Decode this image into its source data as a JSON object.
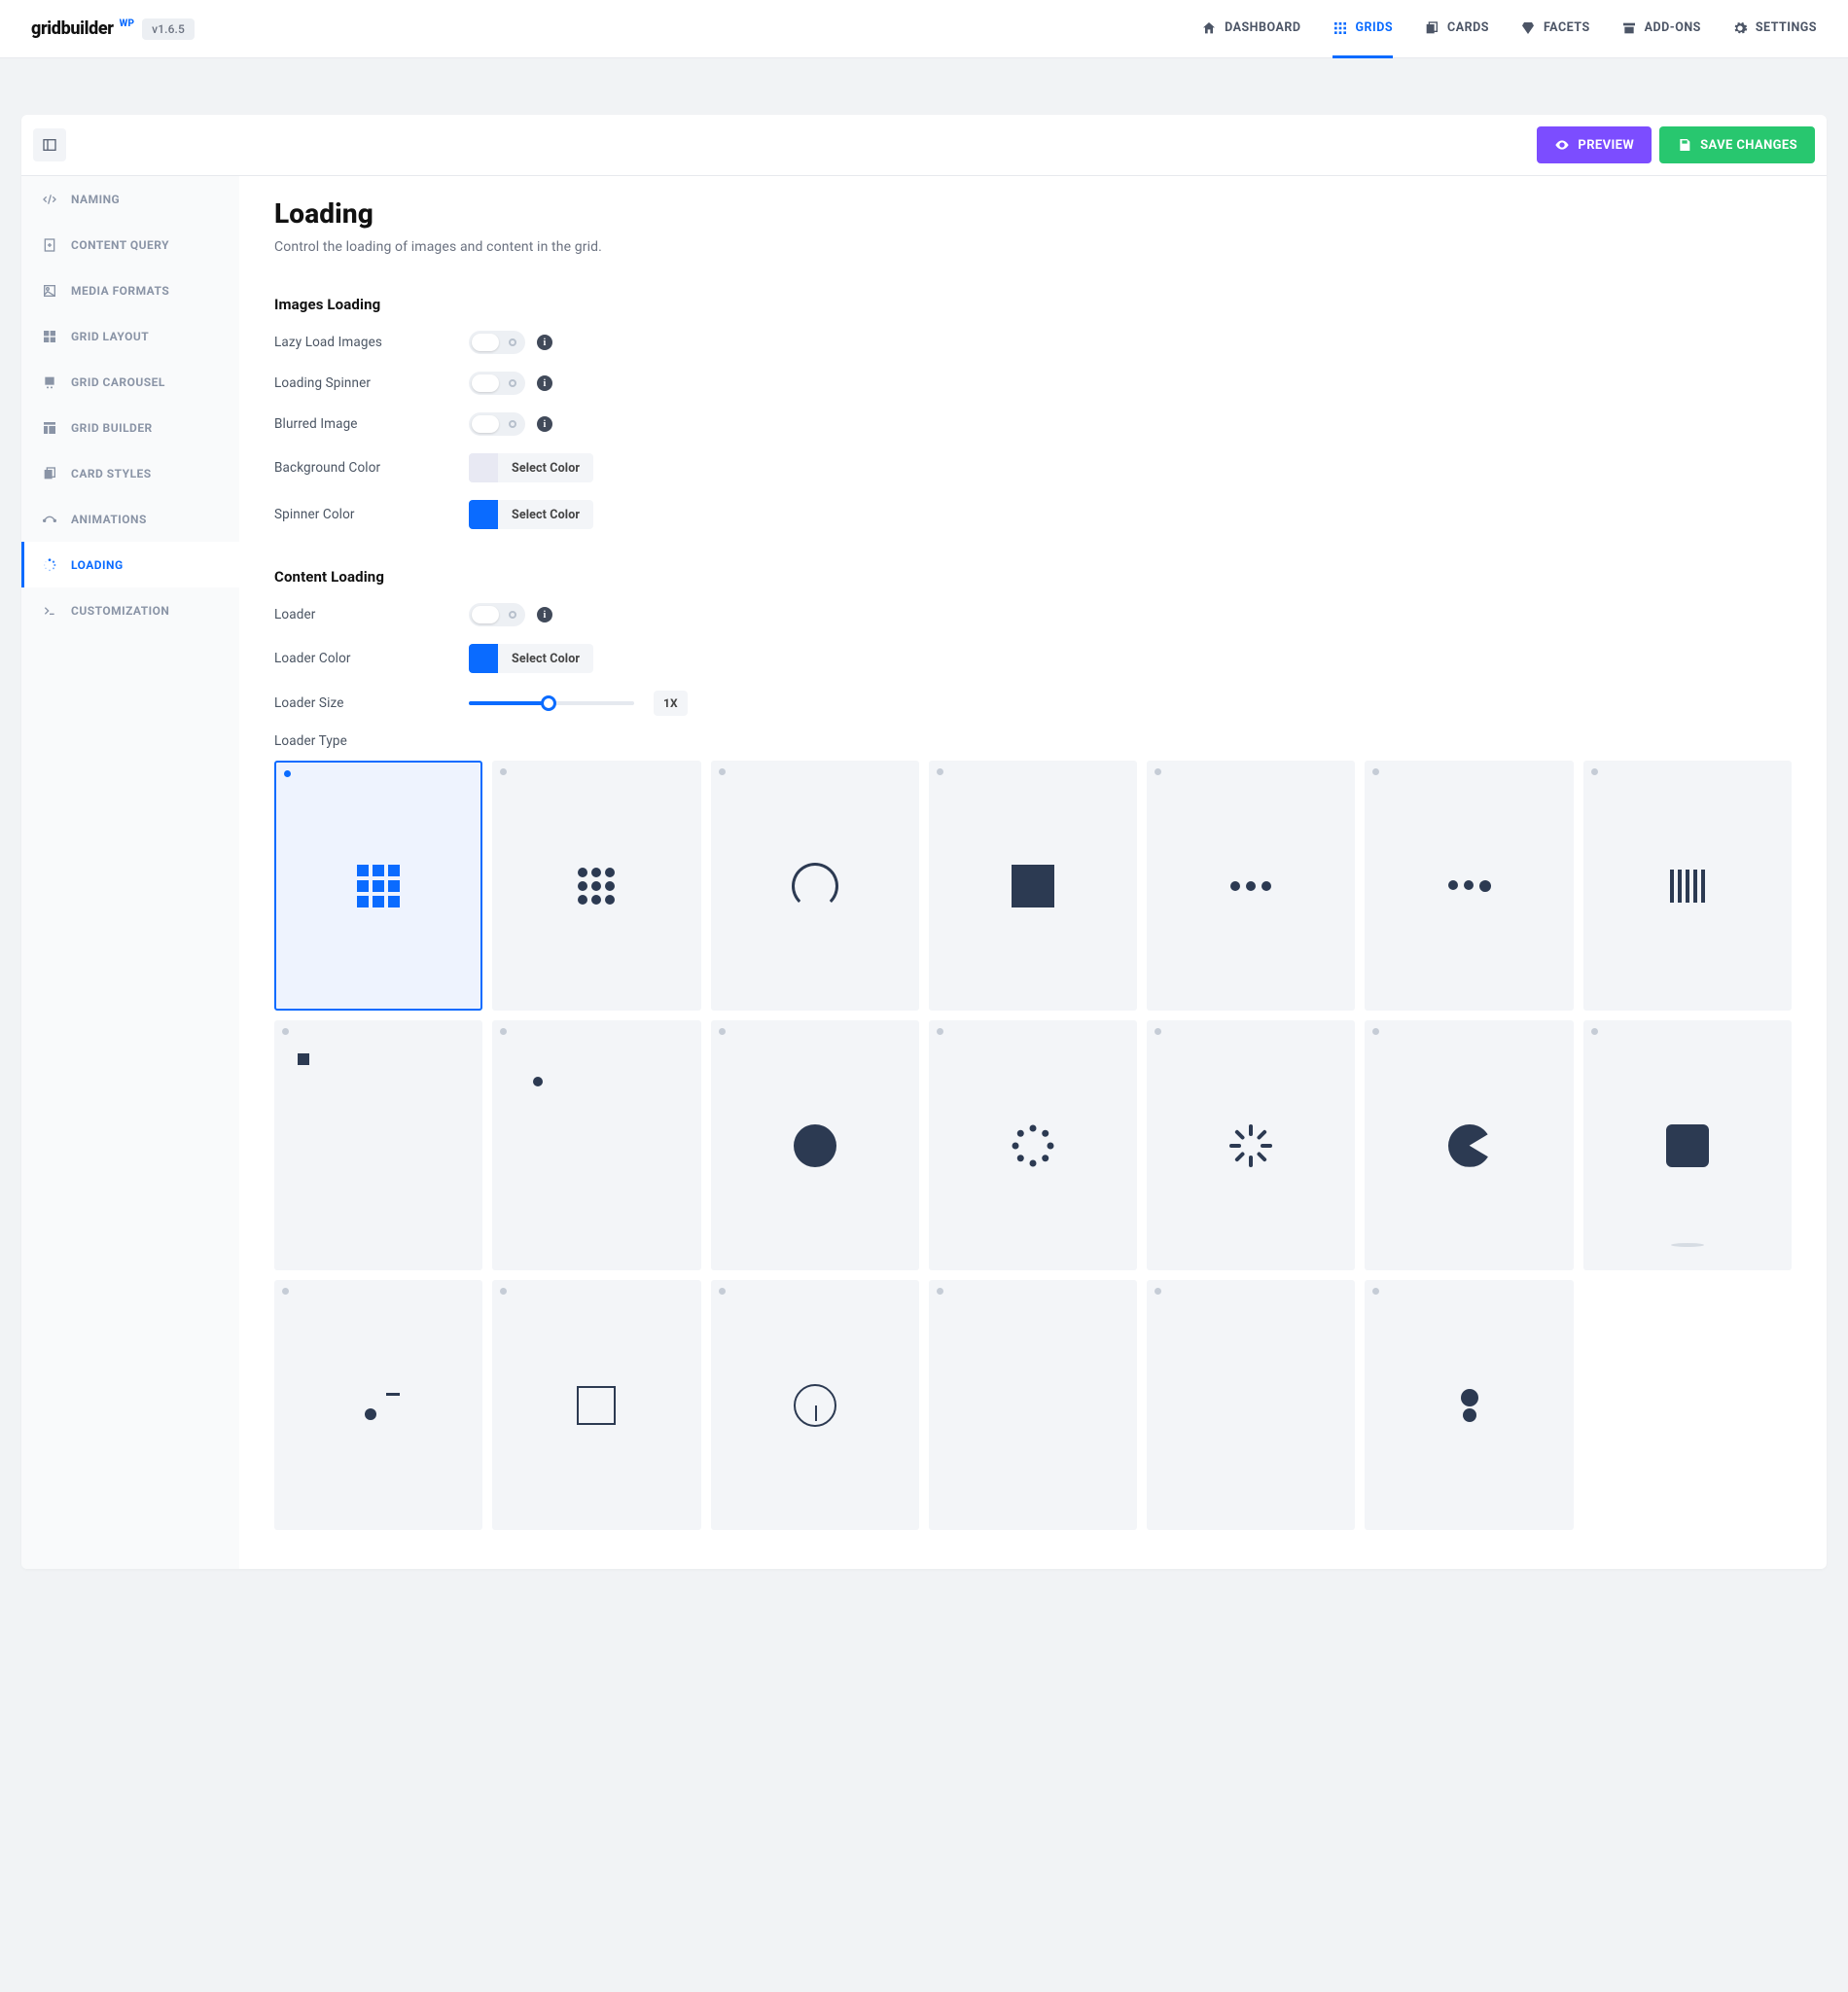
{
  "brand": {
    "name": "gridbuilder",
    "suffix": "WP",
    "version": "v1.6.5"
  },
  "nav": {
    "dashboard": "DASHBOARD",
    "grids": "GRIDS",
    "cards": "CARDS",
    "facets": "FACETS",
    "addons": "ADD-ONS",
    "settings": "SETTINGS"
  },
  "actions": {
    "preview": "PREVIEW",
    "save": "SAVE CHANGES"
  },
  "sidebar": {
    "naming": "NAMING",
    "content_query": "CONTENT QUERY",
    "media_formats": "MEDIA FORMATS",
    "grid_layout": "GRID LAYOUT",
    "grid_carousel": "GRID CAROUSEL",
    "grid_builder": "GRID BUILDER",
    "card_styles": "CARD STYLES",
    "animations": "ANIMATIONS",
    "loading": "LOADING",
    "customization": "CUSTOMIZATION"
  },
  "panel": {
    "title": "Loading",
    "desc": "Control the loading of images and content in the grid.",
    "section_images": "Images Loading",
    "section_content": "Content Loading",
    "labels": {
      "lazy": "Lazy Load Images",
      "spinner": "Loading Spinner",
      "blurred": "Blurred Image",
      "bgcolor": "Background Color",
      "spcolor": "Spinner Color",
      "loader": "Loader",
      "lcolor": "Loader Color",
      "lsize": "Loader Size",
      "ltype": "Loader Type"
    },
    "values": {
      "lazy": false,
      "spinner": false,
      "blurred": false,
      "loader": false,
      "bg_swatch": "#e8e9f3",
      "spinner_swatch": "#0a6bff",
      "loader_swatch": "#0a6bff",
      "select_color_text": "Select Color",
      "loader_size_value": "1X",
      "loader_size_fraction": 0.48,
      "loader_type_selected": 0,
      "loader_type_count": 19
    }
  }
}
